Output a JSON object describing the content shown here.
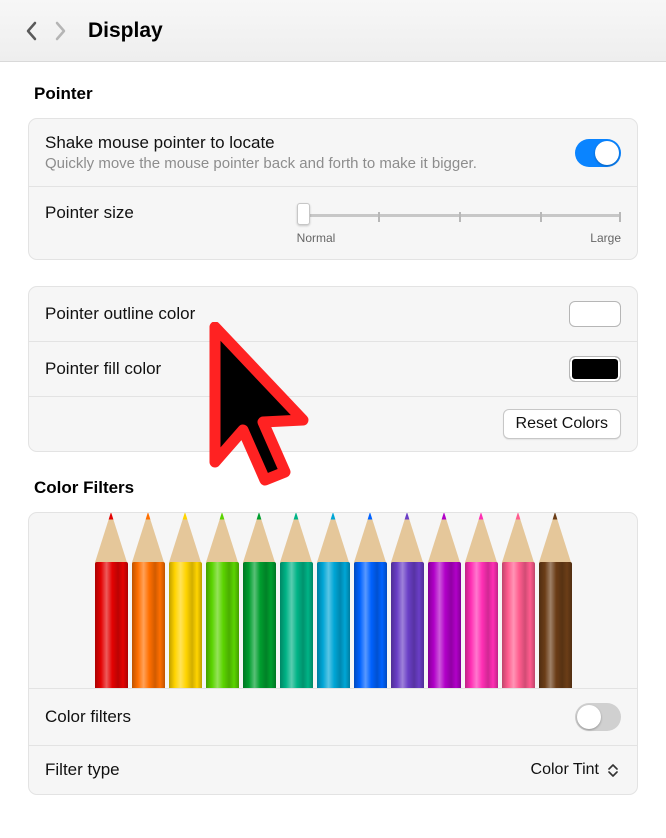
{
  "header": {
    "title": "Display"
  },
  "pointer": {
    "section_label": "Pointer",
    "shake": {
      "title": "Shake mouse pointer to locate",
      "subtitle": "Quickly move the mouse pointer back and forth to make it bigger.",
      "on": true
    },
    "size": {
      "title": "Pointer size",
      "min_label": "Normal",
      "max_label": "Large",
      "value": 0,
      "ticks": 5
    },
    "outline_label": "Pointer outline color",
    "outline_color": "#ffffff",
    "fill_label": "Pointer fill color",
    "fill_color": "#000000",
    "reset_label": "Reset Colors",
    "cursor_overlay": {
      "fill": "#000000",
      "outline": "#ff2222"
    }
  },
  "filters": {
    "section_label": "Color Filters",
    "enable_label": "Color filters",
    "enabled": false,
    "type_label": "Filter type",
    "type_value": "Color Tint",
    "pencil_colors": [
      "#e40303",
      "#ff6f00",
      "#ffd400",
      "#5bd400",
      "#009e2f",
      "#00b386",
      "#00a6d6",
      "#0062ff",
      "#6a3ec6",
      "#b100c8",
      "#ff2fb4",
      "#ff5c8e",
      "#6b3d17"
    ]
  }
}
